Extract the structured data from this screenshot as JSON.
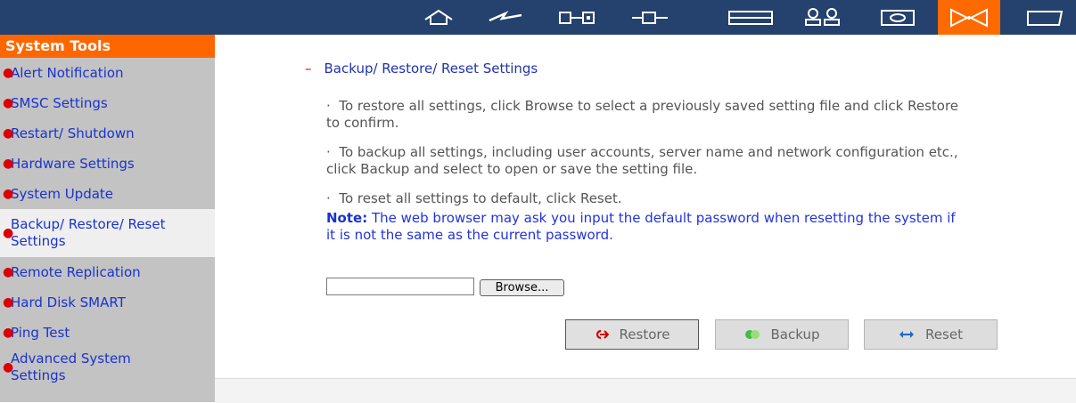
{
  "toolbar": {
    "icons": [
      {
        "name": "home-icon"
      },
      {
        "name": "network-icon"
      },
      {
        "name": "disk-icon"
      },
      {
        "name": "plug-icon"
      },
      {
        "name": "share-icon"
      },
      {
        "name": "users-icon"
      },
      {
        "name": "storage-icon"
      },
      {
        "name": "system-tools-icon",
        "active": true
      },
      {
        "name": "logs-icon"
      }
    ],
    "active_color": "#ff6a00",
    "bar_color": "#25416d"
  },
  "sidebar": {
    "title": "System Tools",
    "items": [
      {
        "label": "Alert Notification"
      },
      {
        "label": "SMSC Settings"
      },
      {
        "label": "Restart/ Shutdown"
      },
      {
        "label": "Hardware Settings"
      },
      {
        "label": "System Update"
      },
      {
        "label": "Backup/ Restore/ Reset Settings",
        "selected": true
      },
      {
        "label": "Remote Replication"
      },
      {
        "label": "Hard Disk SMART"
      },
      {
        "label": "Ping Test"
      },
      {
        "label": "Advanced System Settings"
      }
    ]
  },
  "main": {
    "section_title": "Backup/ Restore/ Reset Settings",
    "bullet": "·",
    "p1": "To restore all settings, click Browse to select a previously saved setting file and click Restore to confirm.",
    "p2": "To backup all settings, including user accounts, server name and network configuration etc., click Backup and select to open or save the setting file.",
    "p3": "To reset all settings to default, click Reset.",
    "note_label": "Note:",
    "note_text": "The web browser may ask you input the default password when resetting the system if it is not the same as the current password.",
    "file_value": "",
    "browse_label": "Browse...",
    "buttons": {
      "restore": "Restore",
      "backup": "Backup",
      "reset": "Reset"
    }
  }
}
